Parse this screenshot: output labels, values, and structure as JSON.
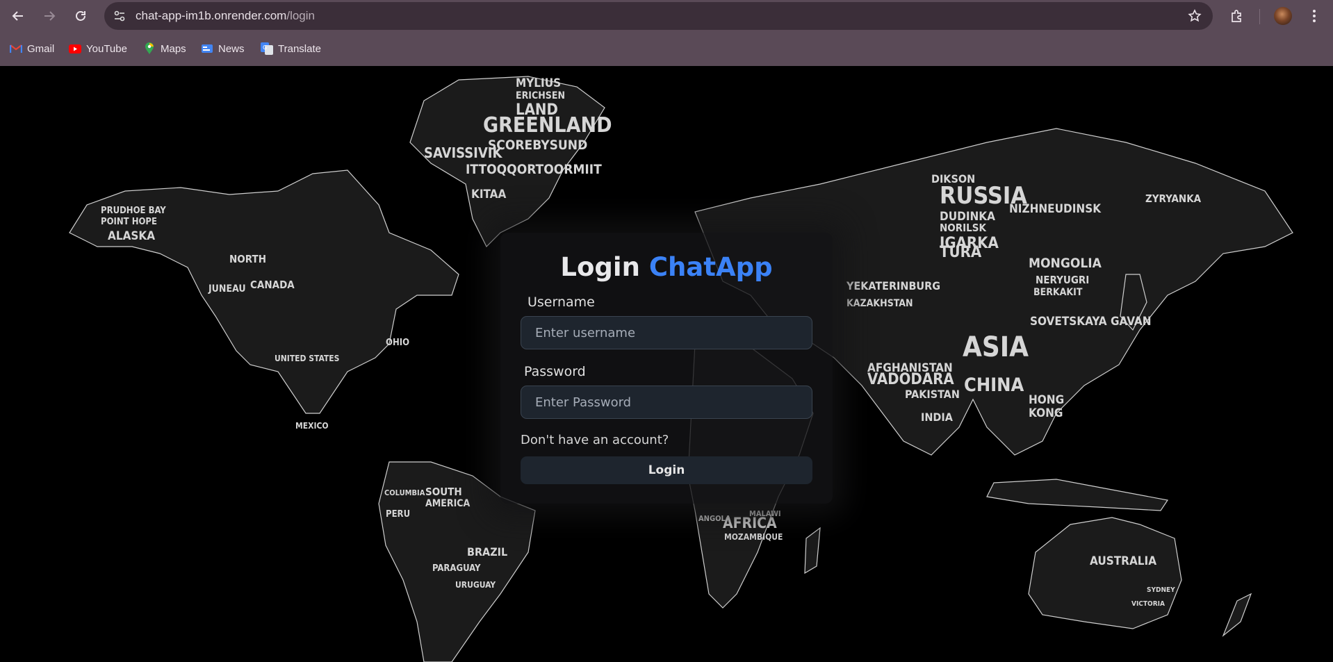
{
  "browser": {
    "url_host": "chat-app-im1b.onrender.com",
    "url_path": "/login",
    "bookmarks": [
      {
        "label": "Gmail",
        "icon": "gmail-icon"
      },
      {
        "label": "YouTube",
        "icon": "youtube-icon"
      },
      {
        "label": "Maps",
        "icon": "maps-icon"
      },
      {
        "label": "News",
        "icon": "news-icon"
      },
      {
        "label": "Translate",
        "icon": "translate-icon"
      }
    ]
  },
  "login": {
    "title_prefix": "Login",
    "title_brand": "ChatApp",
    "username_label": "Username",
    "username_placeholder": "Enter username",
    "password_label": "Password",
    "password_placeholder": "Enter Password",
    "signup_link": "Don't have an account?",
    "submit_label": "Login"
  },
  "colors": {
    "brand": "#3b82f6",
    "chrome": "#5a4a57",
    "input_bg": "#1e252e"
  },
  "background": {
    "map_labels": [
      {
        "text": "GREENLAND",
        "region": "north-atlantic"
      },
      {
        "text": "MYLIUS",
        "region": "north-atlantic"
      },
      {
        "text": "ERICHSEN",
        "region": "north-atlantic"
      },
      {
        "text": "LAND",
        "region": "north-atlantic"
      },
      {
        "text": "SCOREBYSUND",
        "region": "north-atlantic"
      },
      {
        "text": "SAVISSIVIK",
        "region": "north-atlantic"
      },
      {
        "text": "ITTOQQORTOORMIIT",
        "region": "north-atlantic"
      },
      {
        "text": "KITAA",
        "region": "north-atlantic"
      },
      {
        "text": "ALASKA",
        "region": "north-america"
      },
      {
        "text": "POINT HOPE",
        "region": "north-america"
      },
      {
        "text": "PRUDHOE BAY",
        "region": "north-america"
      },
      {
        "text": "NORTH",
        "region": "north-america"
      },
      {
        "text": "CANADA",
        "region": "north-america"
      },
      {
        "text": "JUNEAU",
        "region": "north-america"
      },
      {
        "text": "UNITED STATES",
        "region": "north-america"
      },
      {
        "text": "MEXICO",
        "region": "north-america"
      },
      {
        "text": "OHIO",
        "region": "north-america"
      },
      {
        "text": "RUSSIA",
        "region": "asia"
      },
      {
        "text": "DUDINKA",
        "region": "asia"
      },
      {
        "text": "NORILSK",
        "region": "asia"
      },
      {
        "text": "IGARKA",
        "region": "asia"
      },
      {
        "text": "TURA",
        "region": "asia"
      },
      {
        "text": "NIZHNEUDINSK",
        "region": "asia"
      },
      {
        "text": "MONGOLIA",
        "region": "asia"
      },
      {
        "text": "ASIA",
        "region": "asia"
      },
      {
        "text": "CHINA",
        "region": "asia"
      },
      {
        "text": "INDIA",
        "region": "asia"
      },
      {
        "text": "PAKISTAN",
        "region": "asia"
      },
      {
        "text": "AFGHANISTAN",
        "region": "asia"
      },
      {
        "text": "VADODARA",
        "region": "asia"
      },
      {
        "text": "KAZAKHSTAN",
        "region": "asia"
      },
      {
        "text": "YEKATERINBURG",
        "region": "asia"
      },
      {
        "text": "HONG",
        "region": "asia"
      },
      {
        "text": "KONG",
        "region": "asia"
      },
      {
        "text": "SOVETSKAYA GAVAN",
        "region": "asia"
      },
      {
        "text": "BERKAKIT",
        "region": "asia"
      },
      {
        "text": "NERYUGRI",
        "region": "asia"
      },
      {
        "text": "ZYRYANKA",
        "region": "asia"
      },
      {
        "text": "DIKSON",
        "region": "asia"
      },
      {
        "text": "SOUTH",
        "region": "south-america"
      },
      {
        "text": "AMERICA",
        "region": "south-america"
      },
      {
        "text": "BRAZIL",
        "region": "south-america"
      },
      {
        "text": "PERU",
        "region": "south-america"
      },
      {
        "text": "COLUMBIA",
        "region": "south-america"
      },
      {
        "text": "PARAGUAY",
        "region": "south-america"
      },
      {
        "text": "URUGUAY",
        "region": "south-america"
      },
      {
        "text": "AFRICA",
        "region": "africa"
      },
      {
        "text": "ANGOLA",
        "region": "africa"
      },
      {
        "text": "MOZAMBIQUE",
        "region": "africa"
      },
      {
        "text": "MALAWI",
        "region": "africa"
      },
      {
        "text": "AUSTRALIA",
        "region": "oceania"
      },
      {
        "text": "SYDNEY",
        "region": "oceania"
      },
      {
        "text": "VICTORIA",
        "region": "oceania"
      }
    ]
  }
}
